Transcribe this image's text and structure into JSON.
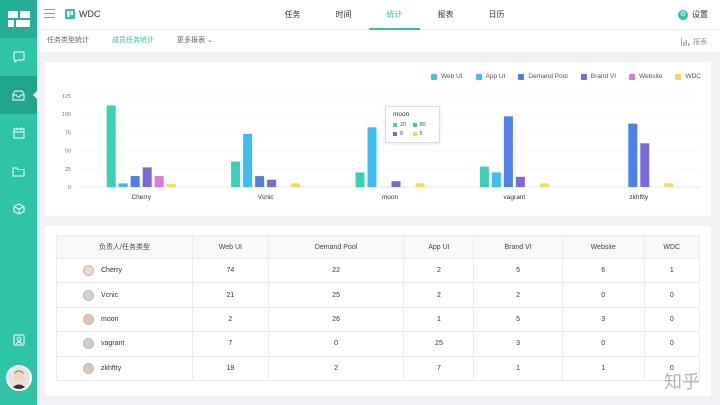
{
  "app": {
    "title": "WDC"
  },
  "nav": {
    "tabs": [
      "任务",
      "时间",
      "统计",
      "报表",
      "日历"
    ],
    "active": 2
  },
  "settings": {
    "label": "设置"
  },
  "subnav": {
    "tabs": [
      "任务类型统计",
      "成员任务统计",
      "更多报表"
    ],
    "active": 1,
    "export_label": "报表"
  },
  "colors": {
    "accent": "#2ec4a6",
    "Web UI": "#3ad0b8",
    "App UI": "#3cbff0",
    "Demand Pool": "#4f80e8",
    "Brand VI": "#7b68d9",
    "Website": "#d67ce0",
    "WDC": "#f0dd5a"
  },
  "chart_data": {
    "type": "bar",
    "categories": [
      "Cherry",
      "Vcnic",
      "moon",
      "vagrant",
      "zkhftty"
    ],
    "series": [
      {
        "name": "Web UI",
        "values": [
          112,
          35,
          20,
          28,
          0
        ]
      },
      {
        "name": "App UI",
        "values": [
          5,
          73,
          82,
          20,
          0
        ]
      },
      {
        "name": "Demand Pool",
        "values": [
          15,
          15,
          0,
          97,
          87
        ]
      },
      {
        "name": "Brand VI",
        "values": [
          27,
          10,
          8,
          14,
          60
        ]
      },
      {
        "name": "Website",
        "values": [
          15,
          0,
          0,
          0,
          0
        ]
      },
      {
        "name": "WDC",
        "values": [
          4,
          5,
          5,
          5,
          5
        ]
      }
    ],
    "ylim": [
      0,
      125
    ],
    "yticks": [
      0,
      25,
      50,
      75,
      100,
      125
    ],
    "legend_position": "top-right",
    "tooltip": {
      "title": "moon",
      "items": [
        {
          "series": "Web UI",
          "value": "20"
        },
        {
          "series": "App UI",
          "value": "80"
        },
        {
          "series": "Brand VI",
          "value": "8"
        },
        {
          "series": "WDC",
          "value": "5"
        }
      ]
    }
  },
  "table": {
    "headers": [
      "负责人/任务类型",
      "Web UI",
      "Demand Pool",
      "App UI",
      "Brand VI",
      "Website",
      "WDC"
    ],
    "rows": [
      {
        "name": "Cherry",
        "values": [
          "74",
          "22",
          "2",
          "5",
          "6",
          "1"
        ]
      },
      {
        "name": "Vcnic",
        "values": [
          "21",
          "25",
          "2",
          "2",
          "0",
          "0"
        ]
      },
      {
        "name": "moon",
        "values": [
          "2",
          "26",
          "1",
          "5",
          "3",
          "0"
        ]
      },
      {
        "name": "vagrant",
        "values": [
          "7",
          "0",
          "25",
          "3",
          "0",
          "0"
        ]
      },
      {
        "name": "zkhftty",
        "values": [
          "19",
          "2",
          "7",
          "1",
          "1",
          "0"
        ]
      }
    ]
  },
  "watermark": "知乎"
}
